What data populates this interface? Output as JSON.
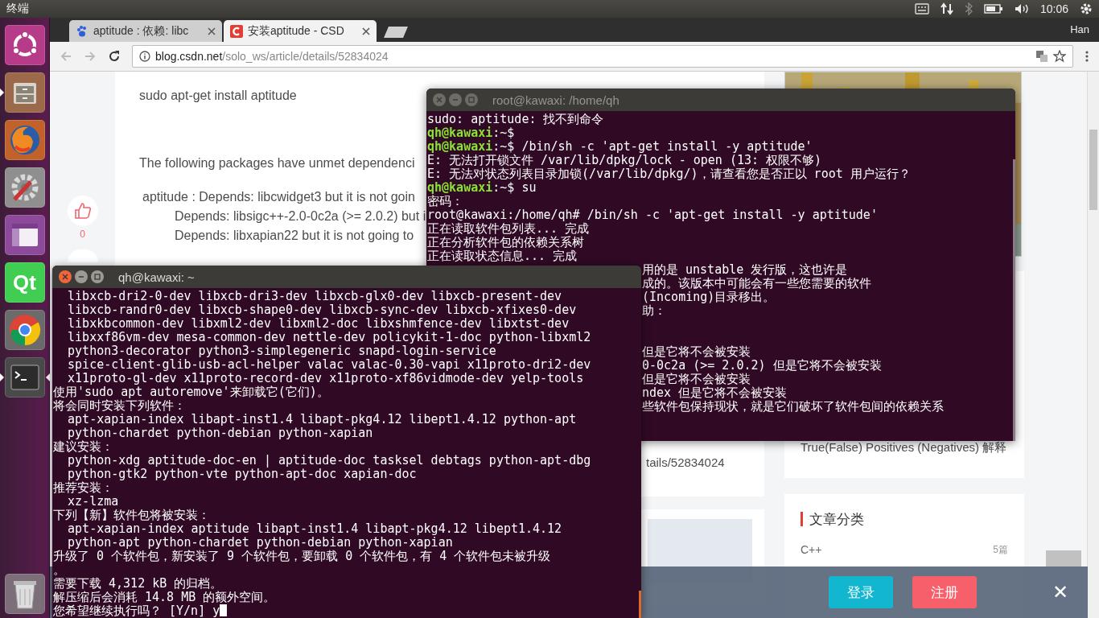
{
  "top_panel": {
    "title": "终端",
    "time": "10:06"
  },
  "launcher": [
    {
      "kind": "ubuntu",
      "running": false
    },
    {
      "kind": "files",
      "running": true
    },
    {
      "kind": "firefox",
      "running": false
    },
    {
      "kind": "settings",
      "running": false
    },
    {
      "kind": "window",
      "running": false
    },
    {
      "kind": "qt",
      "label": "Qt",
      "running": false
    },
    {
      "kind": "chrome",
      "running": false
    },
    {
      "kind": "terminal",
      "running": true
    },
    {
      "kind": "trash",
      "running": false
    }
  ],
  "browser": {
    "tabs": [
      {
        "title": "aptitude : 依赖: libc",
        "selected": false
      },
      {
        "title": "安装aptitude - CSD",
        "selected": true
      }
    ],
    "user": "Han",
    "url_host": "blog.csdn.net",
    "url_path": "/solo_ws/article/details/52834024",
    "like_count": "0",
    "article": [
      {
        "kind": "para",
        "text": "sudo apt-get install aptitude"
      },
      {
        "kind": "para",
        "text": "The following packages have unmet dependenci"
      },
      {
        "kind": "dep",
        "text": "aptitude : Depends: libcwidget3 but it is not goin"
      },
      {
        "kind": "dep_indent",
        "text": "Depends: libsigc++-2.0-0c2a (>= 2.0.2) but i"
      },
      {
        "kind": "dep_indent",
        "text": "Depends: libxapian22 but it is not going to"
      }
    ],
    "related_link": "tails/52834024",
    "sidebar_link": "True(False) Positives (Negatives) 解释",
    "categories": {
      "title": "文章分类",
      "items": [
        {
          "name": "C++",
          "count": "5篇"
        }
      ]
    },
    "login_bar": {
      "login": "登录",
      "register": "注册",
      "close": "✕"
    }
  },
  "terminals": [
    {
      "title": "root@kawaxi: /home/qh",
      "focused": false,
      "lines": [
        {
          "kind": "text",
          "text": "sudo: aptitude: 找不到命令"
        },
        {
          "kind": "prompt",
          "prompt": "qh@kawaxi",
          "text": ":~$"
        },
        {
          "kind": "prompt",
          "prompt": "qh@kawaxi",
          "text": ":~$ /bin/sh -c 'apt-get install -y aptitude'"
        },
        {
          "kind": "text",
          "text": "E: 无法打开锁文件 /var/lib/dpkg/lock - open (13: 权限不够)"
        },
        {
          "kind": "text",
          "text": "E: 无法对状态列表目录加锁(/var/lib/dpkg/)，请查看您是否正以 root 用户运行？"
        },
        {
          "kind": "prompt",
          "prompt": "qh@kawaxi",
          "text": ":~$ su"
        },
        {
          "kind": "text",
          "text": "密码："
        },
        {
          "kind": "text",
          "text": "root@kawaxi:/home/qh# /bin/sh -c 'apt-get install -y aptitude'"
        },
        {
          "kind": "text",
          "text": "正在读取软件包列表... 完成"
        },
        {
          "kind": "text",
          "text": "正在分析软件包的依赖关系树"
        },
        {
          "kind": "text",
          "text": "正在读取状态信息... 完成"
        },
        {
          "kind": "partial",
          "text": "用的是 unstable 发行版，这也许是"
        },
        {
          "kind": "partial",
          "text": "成的。该版本中可能会有一些您需要的软件"
        },
        {
          "kind": "partial",
          "text": "(Incoming)目录移出。"
        },
        {
          "kind": "partial",
          "text": "助："
        },
        {
          "kind": "blank"
        },
        {
          "kind": "blank"
        },
        {
          "kind": "partial",
          "text": "但是它将不会被安装"
        },
        {
          "kind": "partial",
          "text": "0-0c2a (>= 2.0.2) 但是它将不会被安装"
        },
        {
          "kind": "partial",
          "text": "但是它将不会被安装"
        },
        {
          "kind": "partial",
          "text": "ndex 但是它将不会被安装"
        },
        {
          "kind": "partial",
          "text": "些软件包保持现状，就是它们破坏了软件包间的依赖关系"
        }
      ]
    },
    {
      "title": "qh@kawaxi: ~",
      "focused": true,
      "lines": [
        {
          "kind": "text",
          "text": "  libxcb-dri2-0-dev libxcb-dri3-dev libxcb-glx0-dev libxcb-present-dev"
        },
        {
          "kind": "text",
          "text": "  libxcb-randr0-dev libxcb-shape0-dev libxcb-sync-dev libxcb-xfixes0-dev"
        },
        {
          "kind": "text",
          "text": "  libxkbcommon-dev libxml2-dev libxml2-doc libxshmfence-dev libxtst-dev"
        },
        {
          "kind": "text",
          "text": "  libxxf86vm-dev mesa-common-dev nettle-dev policykit-1-doc python-libxml2"
        },
        {
          "kind": "text",
          "text": "  python3-decorator python3-simplegeneric snapd-login-service"
        },
        {
          "kind": "text",
          "text": "  spice-client-glib-usb-acl-helper valac valac-0.30-vapi x11proto-dri2-dev"
        },
        {
          "kind": "text",
          "text": "  x11proto-gl-dev x11proto-record-dev x11proto-xf86vidmode-dev yelp-tools"
        },
        {
          "kind": "text",
          "text": "使用'sudo apt autoremove'来卸载它(它们)。"
        },
        {
          "kind": "text",
          "text": "将会同时安装下列软件："
        },
        {
          "kind": "text",
          "text": "  apt-xapian-index libapt-inst1.4 libapt-pkg4.12 libept1.4.12 python-apt"
        },
        {
          "kind": "text",
          "text": "  python-chardet python-debian python-xapian"
        },
        {
          "kind": "text",
          "text": "建议安装："
        },
        {
          "kind": "text",
          "text": "  python-xdg aptitude-doc-en | aptitude-doc tasksel debtags python-apt-dbg"
        },
        {
          "kind": "text",
          "text": "  python-gtk2 python-vte python-apt-doc xapian-doc"
        },
        {
          "kind": "text",
          "text": "推荐安装："
        },
        {
          "kind": "text",
          "text": "  xz-lzma"
        },
        {
          "kind": "text",
          "text": "下列【新】软件包将被安装："
        },
        {
          "kind": "text",
          "text": "  apt-xapian-index aptitude libapt-inst1.4 libapt-pkg4.12 libept1.4.12"
        },
        {
          "kind": "text",
          "text": "  python-apt python-chardet python-debian python-xapian"
        },
        {
          "kind": "text",
          "text": "升级了 0 个软件包，新安装了 9 个软件包，要卸载 0 个软件包，有 4 个软件包未被升级"
        },
        {
          "kind": "text",
          "text": "。"
        },
        {
          "kind": "text",
          "text": "需要下载 4,312 kB 的归档。"
        },
        {
          "kind": "text",
          "text": "解压缩后会消耗 14.8 MB 的额外空间。"
        },
        {
          "kind": "input",
          "text": "您希望继续执行吗？ [Y/n] y"
        }
      ]
    }
  ]
}
